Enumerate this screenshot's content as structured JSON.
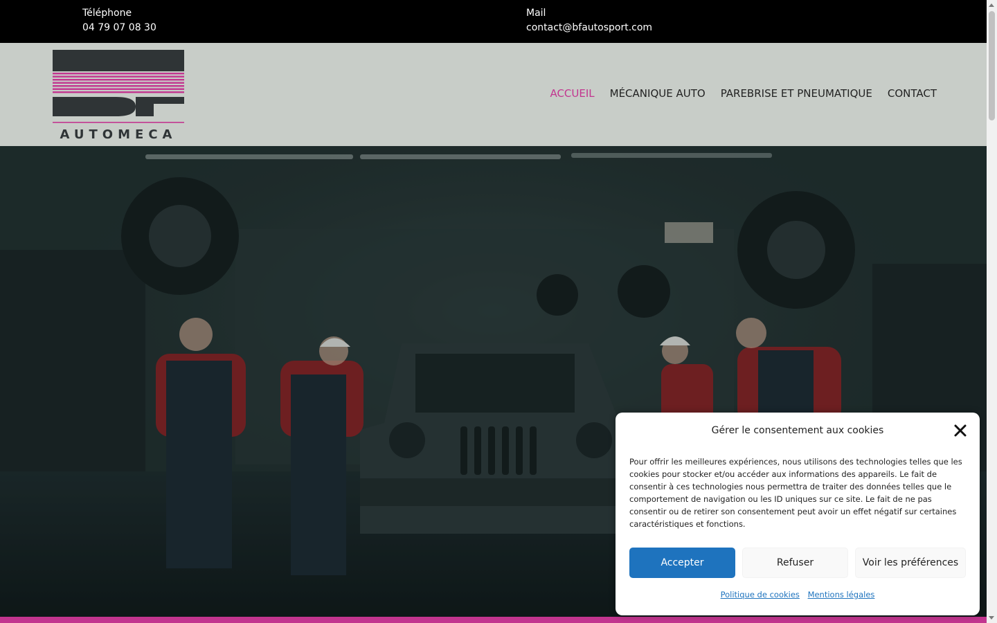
{
  "topbar": {
    "phone_label": "Téléphone",
    "phone_value": "04 79 07 08 30",
    "mail_label": "Mail",
    "mail_value": "contact@bfautosport.com"
  },
  "header": {
    "logo_text": "AUTOMECA",
    "nav": [
      {
        "label": "ACCUEIL",
        "active": true
      },
      {
        "label": "MÉCANIQUE AUTO",
        "active": false
      },
      {
        "label": "PAREBRISE ET PNEUMATIQUE",
        "active": false
      },
      {
        "label": "CONTACT",
        "active": false
      }
    ]
  },
  "cookie": {
    "title": "Gérer le consentement aux cookies",
    "text": "Pour offrir les meilleures expériences, nous utilisons des technologies telles que les cookies pour stocker et/ou accéder aux informations des appareils. Le fait de consentir à ces technologies nous permettra de traiter des données telles que le comportement de navigation ou les ID uniques sur ce site. Le fait de ne pas consentir ou de retirer son consentement peut avoir un effet négatif sur certaines caractéristiques et fonctions.",
    "accept_label": "Accepter",
    "refuse_label": "Refuser",
    "prefs_label": "Voir les préférences",
    "link_policy": "Politique de cookies",
    "link_legal": "Mentions légales"
  },
  "colors": {
    "accent": "#c2358f",
    "button_primary": "#1e73be",
    "header_bg": "#c8cdc8",
    "topbar_bg": "#000000"
  }
}
